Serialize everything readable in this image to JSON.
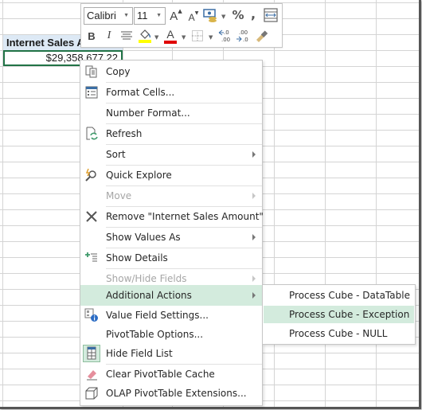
{
  "spreadsheet": {
    "header_cell": "Internet Sales Amount",
    "value_cell": "$29,358,677.22"
  },
  "mini_toolbar": {
    "font_name": "Calibri",
    "font_size": "11",
    "increase_font_label": "A",
    "decrease_font_label": "A",
    "percent_label": "%",
    "comma_label": ",",
    "bold_label": "B",
    "italic_label": "I",
    "font_color_label": "A",
    "increase_decimal_label": ".0 .00",
    "decrease_decimal_label": ".00 .0",
    "highlight_color": "#ffff00",
    "font_color": "#e00000"
  },
  "context_menu": {
    "items": [
      {
        "label": "Copy",
        "icon": "copy-icon",
        "disabled": false,
        "submenu": false
      },
      {
        "label": "Format Cells...",
        "icon": "format-cells-icon",
        "disabled": false,
        "submenu": false
      },
      {
        "label": "Number Format...",
        "icon": "",
        "disabled": false,
        "submenu": false
      },
      {
        "label": "Refresh",
        "icon": "refresh-icon",
        "disabled": false,
        "submenu": false
      },
      {
        "label": "Sort",
        "icon": "",
        "disabled": false,
        "submenu": true
      },
      {
        "label": "Quick Explore",
        "icon": "quick-explore-icon",
        "disabled": false,
        "submenu": false
      },
      {
        "label": "Move",
        "icon": "",
        "disabled": true,
        "submenu": true
      },
      {
        "label": "Remove \"Internet Sales Amount\"",
        "icon": "remove-icon",
        "disabled": false,
        "submenu": false
      },
      {
        "label": "Show Values As",
        "icon": "",
        "disabled": false,
        "submenu": true
      },
      {
        "label": "Show Details",
        "icon": "show-details-icon",
        "disabled": false,
        "submenu": false
      },
      {
        "label": "Show/Hide Fields",
        "icon": "",
        "disabled": true,
        "submenu": true
      },
      {
        "label": "Additional Actions",
        "icon": "",
        "disabled": false,
        "submenu": true,
        "active": true
      },
      {
        "label": "Value Field Settings...",
        "icon": "value-field-settings-icon",
        "disabled": false,
        "submenu": false
      },
      {
        "label": "PivotTable Options...",
        "icon": "",
        "disabled": false,
        "submenu": false
      },
      {
        "label": "Hide Field List",
        "icon": "field-list-icon",
        "disabled": false,
        "submenu": false
      },
      {
        "label": "Clear PivotTable Cache",
        "icon": "eraser-icon",
        "disabled": false,
        "submenu": false
      },
      {
        "label": "OLAP PivotTable Extensions...",
        "icon": "cube-icon",
        "disabled": false,
        "submenu": false
      }
    ]
  },
  "submenu": {
    "items": [
      {
        "label": "Process Cube - DataTable",
        "active": false
      },
      {
        "label": "Process Cube - Exception",
        "active": true
      },
      {
        "label": "Process Cube - NULL",
        "active": false
      }
    ]
  },
  "colors": {
    "selection_border": "#217346",
    "menu_highlight": "#d3ebdd",
    "header_fill": "#dde9f5"
  }
}
